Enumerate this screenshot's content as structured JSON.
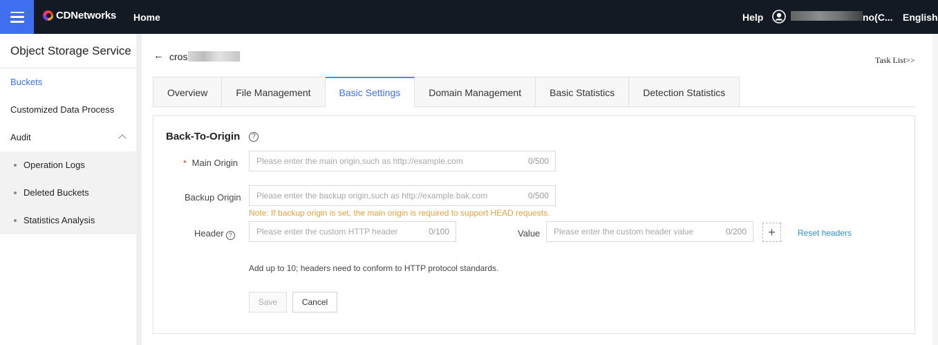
{
  "header": {
    "brand": "CDNetworks",
    "home": "Home",
    "help": "Help",
    "user_suffix": "no(C...",
    "language": "English"
  },
  "sidebar": {
    "title": "Object Storage Service",
    "items": [
      {
        "label": "Buckets",
        "active": true
      },
      {
        "label": "Customized Data Process"
      },
      {
        "label": "Audit"
      }
    ],
    "audit_sub": [
      {
        "label": "Operation Logs"
      },
      {
        "label": "Deleted Buckets"
      },
      {
        "label": "Statistics Analysis"
      }
    ]
  },
  "main": {
    "bucket_name": "cros",
    "task_list": "Task List>>",
    "tabs": [
      {
        "label": "Overview"
      },
      {
        "label": "File Management"
      },
      {
        "label": "Basic Settings",
        "active": true
      },
      {
        "label": "Domain Management"
      },
      {
        "label": "Basic Statistics"
      },
      {
        "label": "Detection Statistics"
      }
    ],
    "section_title": "Back-To-Origin",
    "help_glyph": "?",
    "main_origin": {
      "required_mark": "*",
      "label": "Main Origin",
      "value": "",
      "placeholder": "Please enter the main origin,such as http://example.com",
      "counter": "0/500"
    },
    "backup_origin": {
      "label": "Backup Origin",
      "value": "",
      "placeholder": "Please enter the backup origin,such as http://example.bak.com",
      "counter": "0/500"
    },
    "note": "Note: If backup origin is set, the main origin is required to support HEAD requests.",
    "header_field": {
      "label": "Header",
      "value": "",
      "placeholder": "Please enter the custom HTTP header",
      "counter": "0/100"
    },
    "value_field": {
      "label": "Value",
      "value": "",
      "placeholder": "Please enter the custom header value",
      "counter": "0/200"
    },
    "plus": "+",
    "reset_headers": "Reset headers",
    "hint": "Add up to 10; headers need to conform to HTTP protocol standards.",
    "save": "Save",
    "cancel": "Cancel"
  },
  "colors": {
    "topbar": "#141a24",
    "accent": "#3d6ff0",
    "tab_active_border": "#2f9bd8",
    "note": "#e6a23c",
    "link": "#2f8fd0"
  }
}
